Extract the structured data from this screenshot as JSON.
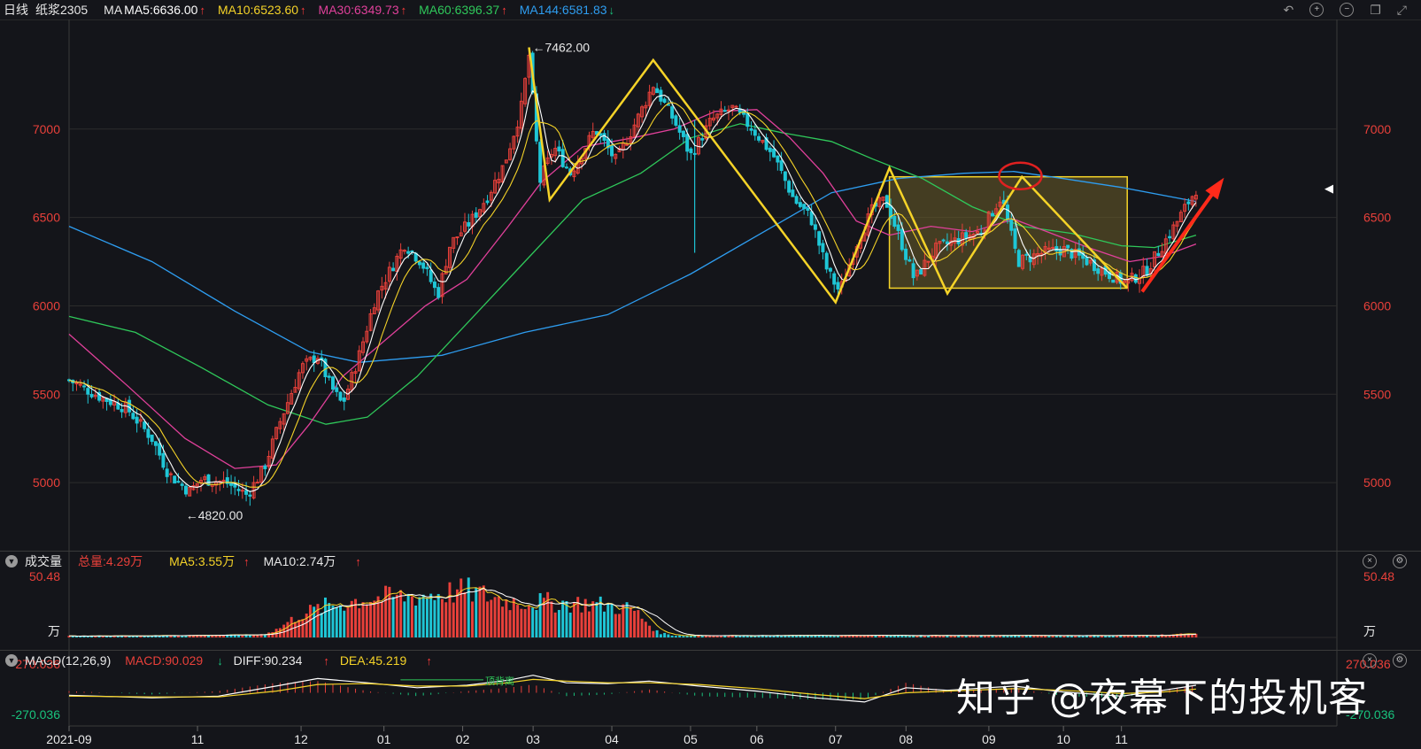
{
  "header": {
    "period": "日线",
    "symbol": "纸浆2305",
    "ma_prefix": "MA",
    "ma": [
      {
        "label": "MA5:6636.00",
        "color": "#ffffff",
        "dir": "up"
      },
      {
        "label": "MA10:6523.60",
        "color": "#f5d328",
        "dir": "up"
      },
      {
        "label": "MA30:6349.73",
        "color": "#e0409a",
        "dir": "up"
      },
      {
        "label": "MA60:6396.37",
        "color": "#2fc85a",
        "dir": "up"
      },
      {
        "label": "MA144:6581.83",
        "color": "#2e9df0",
        "dir": "down"
      }
    ]
  },
  "volume_header": {
    "title": "成交量",
    "total": "总量:4.29万",
    "ma5": "MA5:3.55万",
    "ma10": "MA10:2.74万"
  },
  "macd_header": {
    "title": "MACD(12,26,9)",
    "macd": "MACD:90.029",
    "diff": "DIFF:90.234",
    "dea": "DEA:45.219"
  },
  "watermark": "知乎 @夜幕下的投机客",
  "colors": {
    "up": "#e8403a",
    "down": "#1fc6d6",
    "pattern": "#f5d328",
    "box_fill": "#6b5f2a",
    "circle": "#e02020",
    "arrow": "#ff2a1a",
    "grid": "#2c2c2c"
  },
  "chart_data": {
    "type": "candlestick",
    "price_axis": {
      "ticks": [
        5000,
        5500,
        6000,
        6500,
        7000
      ],
      "labels": [
        "5000",
        "5500",
        "6000",
        "6500",
        "7000"
      ],
      "ylim": [
        4700,
        7620
      ]
    },
    "x_axis": {
      "labels": [
        "2021-09",
        "11",
        "12",
        "01",
        "02",
        "03",
        "04",
        "05",
        "06",
        "07",
        "08",
        "09",
        "10",
        "11"
      ],
      "months_from_start": [
        0,
        1.55,
        2.8,
        3.8,
        4.75,
        5.6,
        6.55,
        7.5,
        8.3,
        9.25,
        10.1,
        11.1,
        12.0,
        12.7
      ],
      "total_months": 15.3
    },
    "high_annotation": "7462.00",
    "high_value": 7462,
    "low_annotation": "4820.00",
    "low_value": 4820,
    "price_path": [
      [
        0,
        5580
      ],
      [
        0.4,
        5480
      ],
      [
        0.7,
        5420
      ],
      [
        1.0,
        5250
      ],
      [
        1.2,
        5050
      ],
      [
        1.45,
        4950
      ],
      [
        1.6,
        5020
      ],
      [
        1.9,
        5000
      ],
      [
        2.15,
        4930
      ],
      [
        2.35,
        5080
      ],
      [
        2.55,
        5350
      ],
      [
        2.8,
        5650
      ],
      [
        3.0,
        5720
      ],
      [
        3.15,
        5550
      ],
      [
        3.3,
        5440
      ],
      [
        3.5,
        5720
      ],
      [
        3.7,
        6050
      ],
      [
        3.85,
        6180
      ],
      [
        4.05,
        6350
      ],
      [
        4.25,
        6250
      ],
      [
        4.45,
        6060
      ],
      [
        4.6,
        6350
      ],
      [
        4.85,
        6480
      ],
      [
        5.05,
        6620
      ],
      [
        5.25,
        6800
      ],
      [
        5.45,
        7100
      ],
      [
        5.55,
        7420
      ],
      [
        5.68,
        6700
      ],
      [
        5.85,
        6900
      ],
      [
        6.05,
        6750
      ],
      [
        6.35,
        7000
      ],
      [
        6.6,
        6820
      ],
      [
        6.85,
        7050
      ],
      [
        7.05,
        7250
      ],
      [
        7.3,
        7050
      ],
      [
        7.5,
        6850
      ],
      [
        7.75,
        7050
      ],
      [
        8.0,
        7120
      ],
      [
        8.25,
        7000
      ],
      [
        8.5,
        6850
      ],
      [
        8.75,
        6600
      ],
      [
        8.95,
        6500
      ],
      [
        9.15,
        6200
      ],
      [
        9.3,
        6080
      ],
      [
        9.5,
        6350
      ],
      [
        9.7,
        6550
      ],
      [
        9.85,
        6600
      ],
      [
        10.05,
        6350
      ],
      [
        10.2,
        6150
      ],
      [
        10.45,
        6320
      ],
      [
        10.75,
        6380
      ],
      [
        11.0,
        6420
      ],
      [
        11.25,
        6620
      ],
      [
        11.45,
        6250
      ],
      [
        11.75,
        6300
      ],
      [
        12.0,
        6320
      ],
      [
        12.3,
        6250
      ],
      [
        12.55,
        6180
      ],
      [
        12.75,
        6130
      ],
      [
        13.0,
        6200
      ],
      [
        13.3,
        6420
      ],
      [
        13.6,
        6660
      ]
    ],
    "ma_lines": [
      {
        "name": "MA144",
        "color": "#2e9df0",
        "points": [
          [
            0,
            6450
          ],
          [
            1.0,
            6250
          ],
          [
            2.0,
            5970
          ],
          [
            2.9,
            5740
          ],
          [
            3.5,
            5680
          ],
          [
            4.5,
            5720
          ],
          [
            5.5,
            5850
          ],
          [
            6.5,
            5950
          ],
          [
            7.5,
            6180
          ],
          [
            8.5,
            6450
          ],
          [
            9.2,
            6640
          ],
          [
            10.0,
            6720
          ],
          [
            10.8,
            6750
          ],
          [
            11.4,
            6760
          ],
          [
            12.0,
            6720
          ],
          [
            12.7,
            6670
          ],
          [
            13.6,
            6590
          ]
        ]
      },
      {
        "name": "MA60",
        "color": "#2fc85a",
        "points": [
          [
            0,
            5940
          ],
          [
            0.8,
            5850
          ],
          [
            1.6,
            5650
          ],
          [
            2.4,
            5440
          ],
          [
            3.1,
            5330
          ],
          [
            3.6,
            5370
          ],
          [
            4.2,
            5600
          ],
          [
            4.8,
            5900
          ],
          [
            5.5,
            6250
          ],
          [
            6.2,
            6600
          ],
          [
            6.9,
            6750
          ],
          [
            7.5,
            6950
          ],
          [
            8.1,
            7030
          ],
          [
            8.6,
            6980
          ],
          [
            9.2,
            6930
          ],
          [
            9.7,
            6830
          ],
          [
            10.3,
            6720
          ],
          [
            10.9,
            6560
          ],
          [
            11.5,
            6450
          ],
          [
            12.1,
            6410
          ],
          [
            12.7,
            6340
          ],
          [
            13.1,
            6330
          ],
          [
            13.6,
            6400
          ]
        ]
      },
      {
        "name": "MA30",
        "color": "#e0409a",
        "points": [
          [
            0,
            5840
          ],
          [
            0.7,
            5550
          ],
          [
            1.4,
            5250
          ],
          [
            2.0,
            5080
          ],
          [
            2.5,
            5100
          ],
          [
            2.9,
            5330
          ],
          [
            3.3,
            5600
          ],
          [
            3.8,
            5800
          ],
          [
            4.3,
            6000
          ],
          [
            4.8,
            6150
          ],
          [
            5.3,
            6450
          ],
          [
            5.7,
            6700
          ],
          [
            6.2,
            6900
          ],
          [
            6.8,
            6950
          ],
          [
            7.3,
            7000
          ],
          [
            7.8,
            7100
          ],
          [
            8.3,
            7110
          ],
          [
            8.7,
            6950
          ],
          [
            9.1,
            6750
          ],
          [
            9.5,
            6480
          ],
          [
            9.9,
            6400
          ],
          [
            10.4,
            6450
          ],
          [
            10.9,
            6420
          ],
          [
            11.4,
            6490
          ],
          [
            11.8,
            6420
          ],
          [
            12.3,
            6330
          ],
          [
            12.8,
            6250
          ],
          [
            13.2,
            6280
          ],
          [
            13.6,
            6350
          ]
        ]
      }
    ],
    "pattern_zigzag": [
      [
        5.55,
        7462
      ],
      [
        5.8,
        6600
      ],
      [
        7.05,
        7390
      ],
      [
        9.25,
        6020
      ],
      [
        9.9,
        6780
      ],
      [
        10.6,
        6070
      ],
      [
        11.5,
        6730
      ],
      [
        12.77,
        6100
      ]
    ],
    "consolidation_box": {
      "x0": 9.9,
      "x1": 12.77,
      "y0": 6100,
      "y1": 6730
    },
    "circle_marker": {
      "x": 11.48,
      "y": 6735
    },
    "trend_arrow": {
      "from": [
        12.95,
        6080
      ],
      "to": [
        13.9,
        6700
      ]
    },
    "volume_axis": {
      "label": "50.48",
      "unit": "万",
      "max": 50.48
    },
    "volume_path": [
      [
        0,
        1
      ],
      [
        2.3,
        2
      ],
      [
        2.5,
        6
      ],
      [
        2.8,
        18
      ],
      [
        3.1,
        24
      ],
      [
        3.6,
        30
      ],
      [
        4.2,
        32
      ],
      [
        4.8,
        36
      ],
      [
        5.3,
        28
      ],
      [
        5.8,
        27
      ],
      [
        6.3,
        26
      ],
      [
        6.8,
        22
      ],
      [
        7.1,
        4
      ],
      [
        7.3,
        1.5
      ],
      [
        13.0,
        1.5
      ],
      [
        13.6,
        3
      ]
    ],
    "macd_axis": {
      "upper": "270.036",
      "lower": "-270.036"
    },
    "macd_annotation": "顶背离",
    "diff_path": [
      [
        0,
        -30
      ],
      [
        1.0,
        -60
      ],
      [
        1.8,
        -40
      ],
      [
        2.5,
        80
      ],
      [
        3.0,
        170
      ],
      [
        3.6,
        120
      ],
      [
        4.2,
        60
      ],
      [
        4.8,
        90
      ],
      [
        5.3,
        150
      ],
      [
        5.6,
        210
      ],
      [
        6.0,
        120
      ],
      [
        6.5,
        110
      ],
      [
        7.0,
        140
      ],
      [
        7.6,
        80
      ],
      [
        8.3,
        20
      ],
      [
        9.0,
        -60
      ],
      [
        9.6,
        -110
      ],
      [
        10.1,
        60
      ],
      [
        10.6,
        30
      ],
      [
        11.4,
        80
      ],
      [
        12.0,
        10
      ],
      [
        12.7,
        -40
      ],
      [
        13.2,
        30
      ],
      [
        13.6,
        90
      ]
    ],
    "dea_path": [
      [
        0,
        -40
      ],
      [
        1.0,
        -50
      ],
      [
        1.8,
        -50
      ],
      [
        2.5,
        20
      ],
      [
        3.0,
        100
      ],
      [
        3.6,
        110
      ],
      [
        4.2,
        80
      ],
      [
        4.8,
        80
      ],
      [
        5.3,
        120
      ],
      [
        5.6,
        160
      ],
      [
        6.0,
        140
      ],
      [
        6.5,
        120
      ],
      [
        7.0,
        120
      ],
      [
        7.6,
        100
      ],
      [
        8.3,
        50
      ],
      [
        9.0,
        -20
      ],
      [
        9.6,
        -70
      ],
      [
        10.1,
        0
      ],
      [
        10.6,
        20
      ],
      [
        11.4,
        50
      ],
      [
        12.0,
        30
      ],
      [
        12.7,
        -10
      ],
      [
        13.2,
        10
      ],
      [
        13.6,
        45
      ]
    ]
  }
}
